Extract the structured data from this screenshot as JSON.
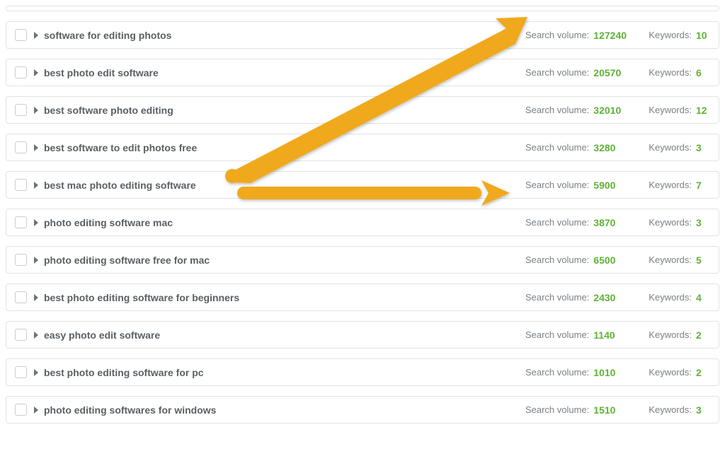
{
  "labels": {
    "search_volume": "Search volume:",
    "keywords": "Keywords:"
  },
  "colors": {
    "value_green": "#5fb336",
    "arrow": "#f0a91f",
    "border": "#dfe3e6",
    "text": "#5a5f64"
  },
  "rows": [
    {
      "title": "software for editing photos",
      "search_volume": "127240",
      "keywords": "10"
    },
    {
      "title": "best photo edit software",
      "search_volume": "20570",
      "keywords": "6"
    },
    {
      "title": "best software photo editing",
      "search_volume": "32010",
      "keywords": "12"
    },
    {
      "title": "best software to edit photos free",
      "search_volume": "3280",
      "keywords": "3"
    },
    {
      "title": "best mac photo editing software",
      "search_volume": "5900",
      "keywords": "7"
    },
    {
      "title": "photo editing software mac",
      "search_volume": "3870",
      "keywords": "3"
    },
    {
      "title": "photo editing software free for mac",
      "search_volume": "6500",
      "keywords": "5"
    },
    {
      "title": "best photo editing software for beginners",
      "search_volume": "2430",
      "keywords": "4"
    },
    {
      "title": "easy photo edit software",
      "search_volume": "1140",
      "keywords": "2"
    },
    {
      "title": "best photo editing software for pc",
      "search_volume": "1010",
      "keywords": "2"
    },
    {
      "title": "photo editing softwares for windows",
      "search_volume": "1510",
      "keywords": "3"
    }
  ]
}
